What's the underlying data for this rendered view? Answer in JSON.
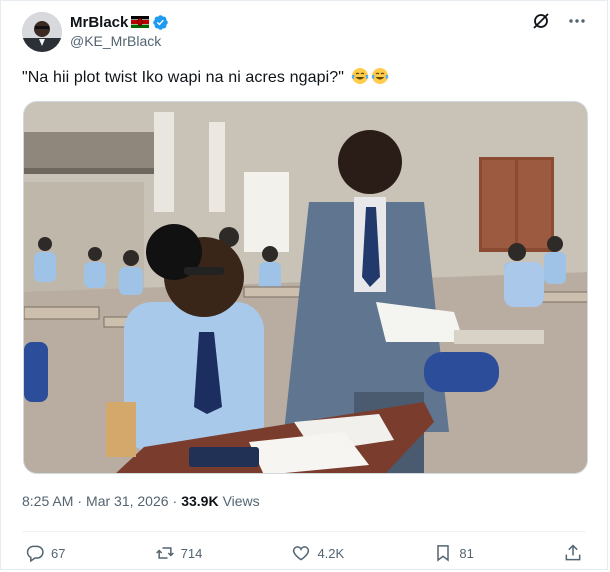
{
  "author": {
    "name": "MrBlack",
    "handle": "@KE_MrBlack",
    "verified_color": "#1d9bf0"
  },
  "tweet": {
    "text": "\"Na hii plot twist Iko wapi na ni acres ngapi?\"",
    "emojis": [
      "face-with-tears-of-joy",
      "face-with-tears-of-joy"
    ],
    "image_alt": ""
  },
  "meta": {
    "time": "8:25 AM",
    "separator": "·",
    "date": "Mar 31, 2026",
    "views_count": "33.9K",
    "views_label": "Views"
  },
  "actions": {
    "replies": "67",
    "reposts": "714",
    "likes": "4.2K",
    "bookmarks": "81"
  },
  "icons": {
    "grok": "grok-icon",
    "more": "more-icon",
    "reply": "reply-icon",
    "repost": "repost-icon",
    "like": "like-icon",
    "bookmark": "bookmark-icon",
    "share": "share-icon"
  }
}
